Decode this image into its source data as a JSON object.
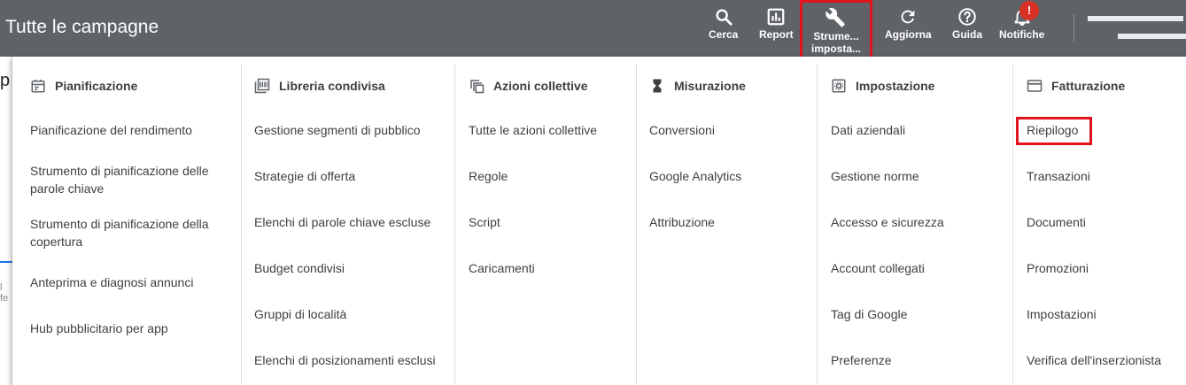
{
  "header": {
    "title": "Tutte le campagne",
    "tools": [
      {
        "label": "Cerca",
        "icon": "search-icon"
      },
      {
        "label": "Report",
        "icon": "report-icon"
      },
      {
        "label": "Strume...",
        "label2": "imposta...",
        "icon": "wrench-icon"
      },
      {
        "label": "Aggiorna",
        "icon": "refresh-icon"
      },
      {
        "label": "Guida",
        "icon": "help-icon"
      },
      {
        "label": "Notifiche",
        "icon": "bell-icon",
        "badge": "!"
      }
    ]
  },
  "background": {
    "partial_letter": "p",
    "partial_text": "l fe"
  },
  "menu": {
    "columns": [
      {
        "title": "Pianificazione",
        "icon": "calendar-icon",
        "items": [
          "Pianificazione del rendimento",
          "Strumento di pianificazione delle parole chiave",
          "Strumento di pianificazione della copertura",
          "Anteprima e diagnosi annunci",
          "Hub pubblicitario per app"
        ]
      },
      {
        "title": "Libreria condivisa",
        "icon": "library-icon",
        "items": [
          "Gestione segmenti di pubblico",
          "Strategie di offerta",
          "Elenchi di parole chiave escluse",
          "Budget condivisi",
          "Gruppi di località",
          "Elenchi di posizionamenti esclusi"
        ]
      },
      {
        "title": "Azioni collettive",
        "icon": "copy-icon",
        "items": [
          "Tutte le azioni collettive",
          "Regole",
          "Script",
          "Caricamenti"
        ]
      },
      {
        "title": "Misurazione",
        "icon": "hourglass-icon",
        "items": [
          "Conversioni",
          "Google Analytics",
          "Attribuzione"
        ]
      },
      {
        "title": "Impostazione",
        "icon": "settings-icon",
        "items": [
          "Dati aziendali",
          "Gestione norme",
          "Accesso e sicurezza",
          "Account collegati",
          "Tag di Google",
          "Preferenze"
        ]
      },
      {
        "title": "Fatturazione",
        "icon": "credit-card-icon",
        "items": [
          "Riepilogo",
          "Transazioni",
          "Documenti",
          "Promozioni",
          "Impostazioni",
          "Verifica dell'inserzionista"
        ]
      }
    ]
  },
  "colors": {
    "topbar": "#5f6368",
    "highlight": "#e3131d",
    "badge": "#d93025",
    "text": "#3c4043"
  }
}
